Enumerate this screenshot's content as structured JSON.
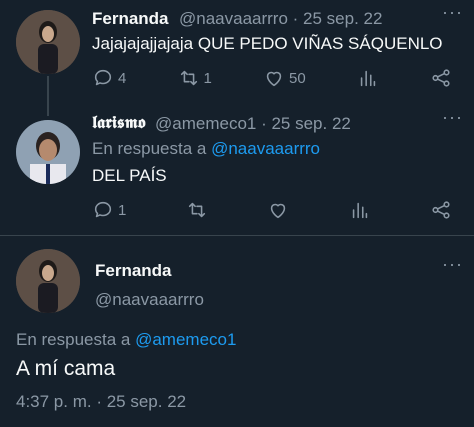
{
  "tweet1": {
    "display_name": "Fernanda",
    "handle_time": "@naavaaarrro · 25 sep. 22",
    "text": "Jajajajajjajaja QUE PEDO VIÑAS SÁQUENLO",
    "reply_count": "4",
    "retweet_count": "1",
    "like_count": "50"
  },
  "tweet2": {
    "display_name": "𝖑𝖆𝖗𝖎𝖘𝖒𝖔",
    "handle_time": "@amemeco1 · 25 sep. 22",
    "reply_prefix": "En respuesta a",
    "reply_to": "@naavaaarrro",
    "text": "DEL PAÍS",
    "reply_count": "1"
  },
  "main_tweet": {
    "display_name": "Fernanda",
    "handle": "@naavaaarrro",
    "reply_prefix": "En respuesta a",
    "reply_to": "@amemeco1",
    "text": "A mí cama",
    "timestamp": "4:37 p. m. · 25 sep. 22"
  },
  "icons": {
    "reply": "reply-icon",
    "retweet": "retweet-icon",
    "like": "heart-icon",
    "analytics": "analytics-icon",
    "share": "share-icon",
    "more": "more-icon"
  },
  "colors": {
    "background": "#15202b",
    "text": "#f7f9f9",
    "muted": "#8b98a5",
    "link": "#1d9bf0"
  }
}
